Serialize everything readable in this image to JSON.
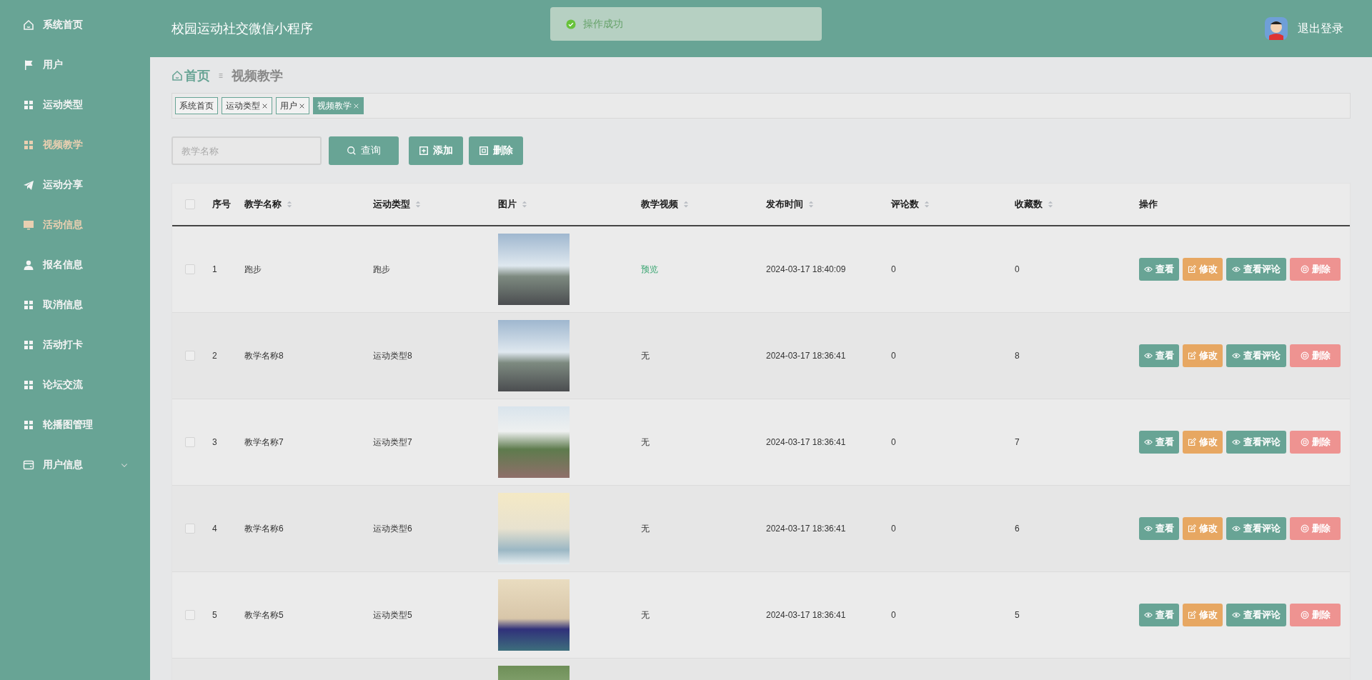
{
  "sidebar": {
    "items": [
      {
        "label": "系统首页",
        "selected": false,
        "expandable": false
      },
      {
        "label": "用户",
        "selected": false,
        "expandable": false
      },
      {
        "label": "运动类型",
        "selected": false,
        "expandable": false
      },
      {
        "label": "视频教学",
        "selected": true,
        "expandable": false
      },
      {
        "label": "运动分享",
        "selected": false,
        "expandable": false
      },
      {
        "label": "活动信息",
        "selected": true,
        "expandable": false
      },
      {
        "label": "报名信息",
        "selected": false,
        "expandable": false
      },
      {
        "label": "取消信息",
        "selected": false,
        "expandable": false
      },
      {
        "label": "活动打卡",
        "selected": false,
        "expandable": false
      },
      {
        "label": "论坛交流",
        "selected": false,
        "expandable": false
      },
      {
        "label": "轮播图管理",
        "selected": false,
        "expandable": false
      },
      {
        "label": "用户信息",
        "selected": false,
        "expandable": true
      }
    ]
  },
  "header": {
    "title": "校园运动社交微信小程序",
    "logout": "退出登录"
  },
  "toast": {
    "message": "操作成功"
  },
  "breadcrumb": {
    "home": "首页",
    "current": "视频教学"
  },
  "tabs": [
    {
      "label": "系统首页",
      "selected": false,
      "closable": false
    },
    {
      "label": "运动类型",
      "selected": false,
      "closable": true
    },
    {
      "label": "用户",
      "selected": false,
      "closable": true
    },
    {
      "label": "视频教学",
      "selected": true,
      "closable": true
    }
  ],
  "toolbar": {
    "search": {
      "placeholder": "教学名称"
    },
    "buttons": [
      {
        "label": "查询",
        "kind": "search"
      },
      {
        "label": "添加",
        "kind": "add"
      },
      {
        "label": "删除",
        "kind": "delete"
      }
    ]
  },
  "table": {
    "select_all_checked": false,
    "columns": [
      {
        "label": "序号",
        "sortable": false
      },
      {
        "label": "教学名称",
        "sortable": true
      },
      {
        "label": "运动类型",
        "sortable": true
      },
      {
        "label": "图片",
        "sortable": true
      },
      {
        "label": "教学视频",
        "sortable": true
      },
      {
        "label": "发布时间",
        "sortable": true
      },
      {
        "label": "评论数",
        "sortable": true
      },
      {
        "label": "收藏数",
        "sortable": true
      },
      {
        "label": "操作",
        "sortable": false
      }
    ],
    "rows": [
      {
        "checked": false,
        "index": "1",
        "name": "跑步",
        "type": "跑步",
        "video": "预览",
        "video_link": true,
        "time": "2024-03-17 18:40:09",
        "comments": "0",
        "favorites": "0",
        "actions": [
          {
            "label": "查看",
            "kind": "view"
          },
          {
            "label": "修改",
            "kind": "edit"
          },
          {
            "label": "查看评论",
            "kind": "view"
          },
          {
            "label": "删除",
            "kind": "delete"
          }
        ]
      },
      {
        "checked": false,
        "index": "2",
        "name": "教学名称8",
        "type": "运动类型8",
        "video": "无",
        "video_link": false,
        "time": "2024-03-17 18:36:41",
        "comments": "0",
        "favorites": "8",
        "actions": [
          {
            "label": "查看",
            "kind": "view"
          },
          {
            "label": "修改",
            "kind": "edit"
          },
          {
            "label": "查看评论",
            "kind": "view"
          },
          {
            "label": "删除",
            "kind": "delete"
          }
        ]
      },
      {
        "checked": false,
        "index": "3",
        "name": "教学名称7",
        "type": "运动类型7",
        "video": "无",
        "video_link": false,
        "time": "2024-03-17 18:36:41",
        "comments": "0",
        "favorites": "7",
        "actions": [
          {
            "label": "查看",
            "kind": "view"
          },
          {
            "label": "修改",
            "kind": "edit"
          },
          {
            "label": "查看评论",
            "kind": "view"
          },
          {
            "label": "删除",
            "kind": "delete"
          }
        ]
      },
      {
        "checked": false,
        "index": "4",
        "name": "教学名称6",
        "type": "运动类型6",
        "video": "无",
        "video_link": false,
        "time": "2024-03-17 18:36:41",
        "comments": "0",
        "favorites": "6",
        "actions": [
          {
            "label": "查看",
            "kind": "view"
          },
          {
            "label": "修改",
            "kind": "edit"
          },
          {
            "label": "查看评论",
            "kind": "view"
          },
          {
            "label": "删除",
            "kind": "delete"
          }
        ]
      },
      {
        "checked": false,
        "index": "5",
        "name": "教学名称5",
        "type": "运动类型5",
        "video": "无",
        "video_link": false,
        "time": "2024-03-17 18:36:41",
        "comments": "0",
        "favorites": "5",
        "actions": [
          {
            "label": "查看",
            "kind": "view"
          },
          {
            "label": "修改",
            "kind": "edit"
          },
          {
            "label": "查看评论",
            "kind": "view"
          },
          {
            "label": "删除",
            "kind": "delete"
          }
        ]
      }
    ]
  }
}
